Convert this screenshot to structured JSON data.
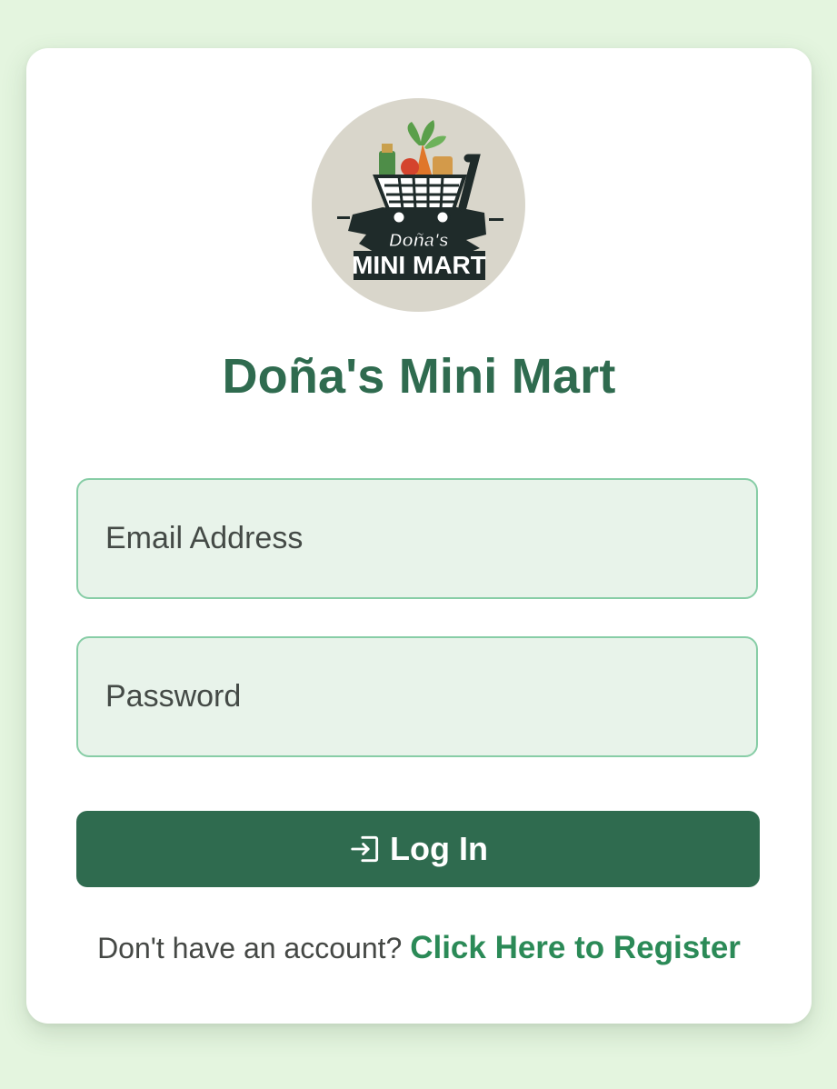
{
  "logo": {
    "line1": "Doña's",
    "line2": "MINI MART"
  },
  "title": "Doña's Mini Mart",
  "form": {
    "email_placeholder": "Email Address",
    "password_placeholder": "Password",
    "login_label": "Log In"
  },
  "register": {
    "prompt": "Don't have an account?",
    "link_label": "Click Here to Register"
  },
  "colors": {
    "page_background": "#e4f5df",
    "brand_green": "#2f6b4f",
    "link_green": "#2b8a57",
    "field_background": "#e8f3ea",
    "field_border": "#87cda6"
  },
  "icons": {
    "logo": "shopping-cart-icon",
    "login": "login-icon"
  }
}
